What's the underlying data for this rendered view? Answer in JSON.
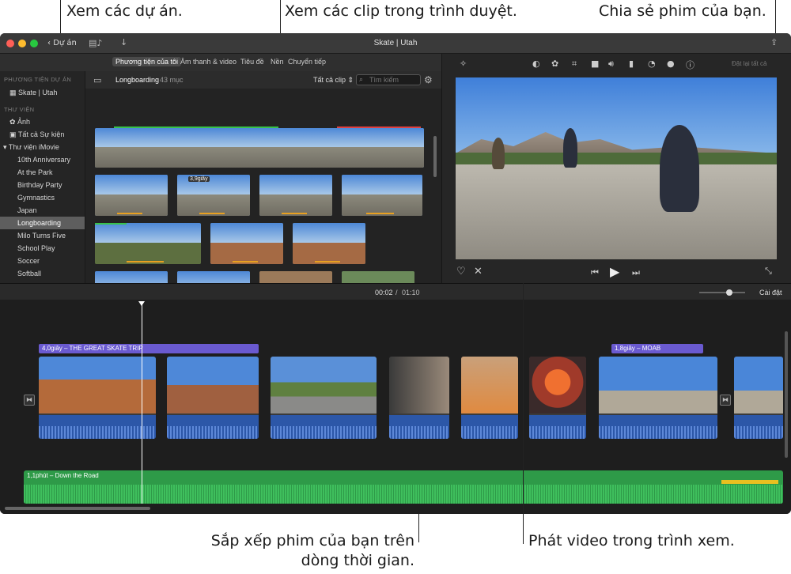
{
  "callouts": {
    "projects": "Xem các dự án.",
    "browser": "Xem các clip trong trình duyệt.",
    "share": "Chia sẻ phim của bạn.",
    "timeline_line1": "Sắp xếp phim của bạn trên",
    "timeline_line2": "dòng thời gian.",
    "viewer": "Phát video trong trình xem."
  },
  "window": {
    "title": "Skate | Utah",
    "back_label": "Dự án"
  },
  "tabs": [
    "Phương tiện của tôi",
    "Âm thanh & video",
    "Tiêu đề",
    "Nền",
    "Chuyển tiếp"
  ],
  "sidebar": {
    "section_projects": "PHƯƠNG TIỆN DỰ ÁN",
    "project_item": "Skate | Utah",
    "section_library": "THƯ VIỆN",
    "photos": "Ảnh",
    "all_events": "Tất cả Sự kiện",
    "imovie_library": "Thư viện iMovie",
    "events": [
      "10th Anniversary",
      "At the Park",
      "Birthday Party",
      "Gymnastics",
      "Japan",
      "Longboarding",
      "Milo Turns Five",
      "School Play",
      "Soccer",
      "Softball"
    ],
    "selected_event": "Longboarding"
  },
  "browser": {
    "event_name": "Longboarding",
    "item_count": "43 mục",
    "filter": "Tất cả clip",
    "search_placeholder": "Tìm kiếm",
    "clip_duration_badge": "3,9giây"
  },
  "viewer": {
    "reset_all": "Đặt lại tất cả"
  },
  "timeline": {
    "time_current": "00:02",
    "time_separator": "/",
    "time_total": "01:10",
    "settings": "Cài đặt",
    "title_clip_1": "4,0giây – THE GREAT SKATE TRIP",
    "title_clip_2": "1,8giây – MOAB",
    "music_clip": "1,1phút – Down the Road"
  },
  "colors": {
    "accent_purple": "#6a5ad0",
    "audio_blue": "#2c57a8",
    "music_green": "#2e9a48",
    "selection": "#5e5e5e"
  }
}
